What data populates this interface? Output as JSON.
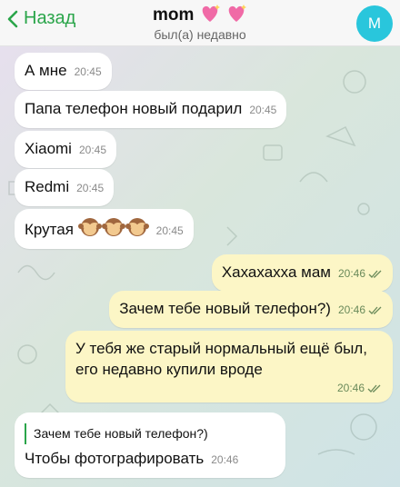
{
  "header": {
    "back_label": "Назад",
    "chat_title": "mom",
    "status": "был(а) недавно",
    "avatar_letter": "M"
  },
  "messages": [
    {
      "side": "in",
      "text": "А мне",
      "time": "20:45"
    },
    {
      "side": "in",
      "text": "Папа телефон новый подарил",
      "time": "20:45"
    },
    {
      "side": "in",
      "text": "Xiaomi",
      "time": "20:45"
    },
    {
      "side": "in",
      "text": "Redmi",
      "time": "20:45"
    },
    {
      "side": "in",
      "text": "Крутая",
      "emoji": "see-no-evil-monkey x3",
      "time": "20:45"
    },
    {
      "side": "out",
      "text": "Хахахахха мам",
      "time": "20:46",
      "status": "read"
    },
    {
      "side": "out",
      "text": "Зачем тебе новый телефон?)",
      "time": "20:46",
      "status": "read"
    },
    {
      "side": "out",
      "text": "У тебя же старый нормальный ещё был, его недавно купили вроде",
      "time": "20:46",
      "status": "read"
    },
    {
      "side": "in",
      "reply_to": "Зачем тебе новый телефон?)",
      "text": "Чтобы фотографировать",
      "time": "20:46"
    }
  ],
  "colors": {
    "accent": "#2aa54a",
    "incoming_bubble": "#ffffff",
    "outgoing_bubble": "#fcf6c6",
    "avatar_bg": "#29c6dc"
  }
}
